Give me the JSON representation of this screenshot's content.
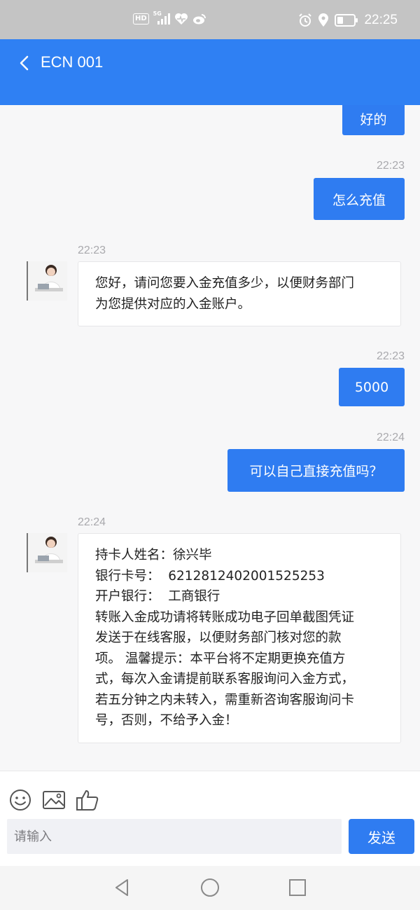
{
  "status_bar": {
    "hd_label": "HD",
    "net_label": "5G",
    "time": "22:25",
    "icons": [
      "signal-icon",
      "heart-health-icon",
      "weibo-icon",
      "alarm-icon",
      "location-icon",
      "battery-icon"
    ]
  },
  "header": {
    "title": "ECN 001",
    "back_icon": "chevron-left-icon",
    "background": "#2f80f3"
  },
  "messages": [
    {
      "direction": "out",
      "text": "好的"
    },
    {
      "direction": "out",
      "time": "22:23",
      "text": "怎么充值"
    },
    {
      "direction": "in",
      "time": "22:23",
      "lines": [
        "您好，请问您要入金充值多少，以便财务部门",
        "为您提供对应的入金账户。"
      ]
    },
    {
      "direction": "out",
      "time": "22:23",
      "text": "5000"
    },
    {
      "direction": "out",
      "time": "22:24",
      "text": "可以自己直接充值吗？"
    },
    {
      "direction": "in",
      "time": "22:24",
      "lines": [
        "持卡人姓名：徐兴毕",
        "银行卡号：  6212812402001525253",
        "开户银行：  工商银行",
        "转账入金成功请将转账成功电子回单截图凭证",
        "发送于在线客服，以便财务部门核对您的款",
        "项。 温馨提示：本平台将不定期更换充值方",
        "式，每次入金请提前联系客服询问入金方式，",
        "若五分钟之内未转入，需重新咨询客服询问卡",
        "号，否则，不给予入金！"
      ]
    }
  ],
  "composer": {
    "placeholder": "请输入",
    "send_label": "发送",
    "tools": [
      "emoji-icon",
      "image-icon",
      "thumbs-up-icon"
    ]
  },
  "nav": {
    "buttons": [
      "back-triangle-icon",
      "home-circle-icon",
      "recents-square-icon"
    ]
  },
  "colors": {
    "accent": "#2f7cf1",
    "chat_background": "#f7f7f8",
    "timestamp": "#a9a9ad"
  }
}
